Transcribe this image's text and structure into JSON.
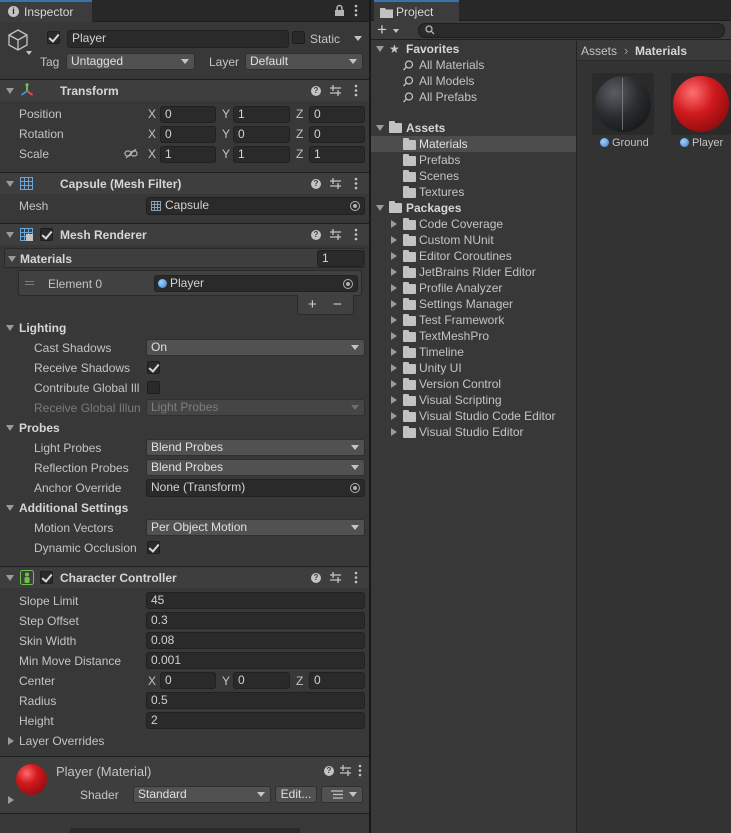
{
  "inspector": {
    "tab_label": "Inspector",
    "object": {
      "name": "Player",
      "static_label": "Static",
      "tag_label": "Tag",
      "tag_value": "Untagged",
      "layer_label": "Layer",
      "layer_value": "Default"
    },
    "transform": {
      "title": "Transform",
      "rows": [
        {
          "label": "Position",
          "x": "0",
          "y": "1",
          "z": "0"
        },
        {
          "label": "Rotation",
          "x": "0",
          "y": "0",
          "z": "0"
        },
        {
          "label": "Scale",
          "x": "1",
          "y": "1",
          "z": "1"
        }
      ],
      "axis": {
        "x": "X",
        "y": "Y",
        "z": "Z"
      }
    },
    "mesh_filter": {
      "title": "Capsule (Mesh Filter)",
      "mesh_label": "Mesh",
      "mesh_value": "Capsule"
    },
    "mesh_renderer": {
      "title": "Mesh Renderer",
      "materials_label": "Materials",
      "materials_count": "1",
      "element_label": "Element 0",
      "element_value": "Player",
      "add": "+",
      "remove": "−",
      "lighting": {
        "title": "Lighting",
        "cast_shadows_label": "Cast Shadows",
        "cast_shadows_value": "On",
        "receive_shadows_label": "Receive Shadows",
        "contribute_gi_label": "Contribute Global Ill",
        "receive_gi_label": "Receive Global Illun",
        "receive_gi_value": "Light Probes"
      },
      "probes": {
        "title": "Probes",
        "light_probes_label": "Light Probes",
        "light_probes_value": "Blend Probes",
        "reflection_probes_label": "Reflection Probes",
        "reflection_probes_value": "Blend Probes",
        "anchor_label": "Anchor Override",
        "anchor_value": "None (Transform)"
      },
      "additional": {
        "title": "Additional Settings",
        "motion_label": "Motion Vectors",
        "motion_value": "Per Object Motion",
        "occlusion_label": "Dynamic Occlusion"
      }
    },
    "character_controller": {
      "title": "Character Controller",
      "rows": [
        {
          "label": "Slope Limit",
          "value": "45"
        },
        {
          "label": "Step Offset",
          "value": "0.3"
        },
        {
          "label": "Skin Width",
          "value": "0.08"
        },
        {
          "label": "Min Move Distance",
          "value": "0.001"
        }
      ],
      "center_label": "Center",
      "center": {
        "x": "0",
        "y": "0",
        "z": "0"
      },
      "radius_label": "Radius",
      "radius_value": "0.5",
      "height_label": "Height",
      "height_value": "2",
      "layer_overrides_label": "Layer Overrides"
    },
    "material": {
      "title": "Player (Material)",
      "shader_label": "Shader",
      "shader_value": "Standard",
      "edit_label": "Edit..."
    }
  },
  "project": {
    "tab_label": "Project",
    "add_label": "+",
    "breadcrumb": [
      "Assets",
      "Materials"
    ],
    "favorites": {
      "title": "Favorites",
      "items": [
        "All Materials",
        "All Models",
        "All Prefabs"
      ]
    },
    "assets": {
      "title": "Assets",
      "items": [
        "Materials",
        "Prefabs",
        "Scenes",
        "Textures"
      ]
    },
    "packages": {
      "title": "Packages",
      "items": [
        "Code Coverage",
        "Custom NUnit",
        "Editor Coroutines",
        "JetBrains Rider Editor",
        "Profile Analyzer",
        "Settings Manager",
        "Test Framework",
        "TextMeshPro",
        "Timeline",
        "Unity UI",
        "Version Control",
        "Visual Scripting",
        "Visual Studio Code Editor",
        "Visual Studio Editor"
      ]
    },
    "grid": [
      {
        "name": "Ground",
        "color": "#2a2d30"
      },
      {
        "name": "Player",
        "color": "#c8181c"
      }
    ]
  },
  "colors": {
    "accent": "#3a72b0",
    "panel": "#383838",
    "header": "#3e3e3e",
    "field": "#2a2a2a"
  }
}
